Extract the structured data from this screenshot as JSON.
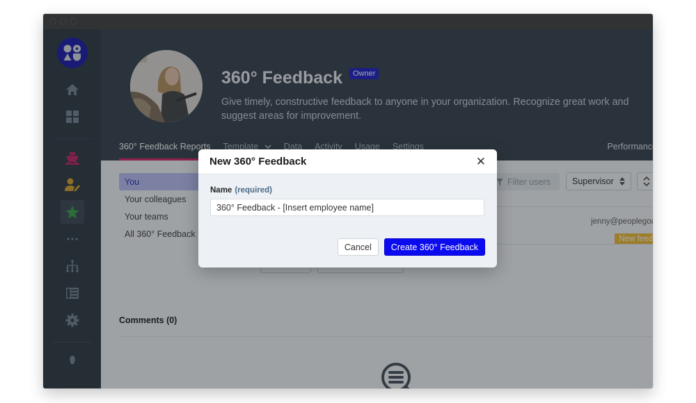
{
  "window": {
    "traffic_lights": [
      "close",
      "minimize",
      "maximize"
    ]
  },
  "sidebar": {
    "logo": "peoplegoal-logo",
    "items": [
      {
        "icon": "home-icon",
        "label": "Home",
        "color": "#6f7f8c"
      },
      {
        "icon": "grid-icon",
        "label": "Dashboard",
        "color": "#6f7f8c"
      },
      {
        "icon": "ship-icon",
        "label": "Onboarding",
        "color": "#c2185b"
      },
      {
        "icon": "user-edit-icon",
        "label": "Reviews",
        "color": "#d39e21"
      },
      {
        "icon": "star-icon",
        "label": "360° Feedback",
        "color": "#2e9e3e",
        "active": true
      },
      {
        "icon": "more-icon",
        "label": "More",
        "color": "#6f7f8c"
      },
      {
        "icon": "org-chart-icon",
        "label": "Org chart",
        "color": "#6f7f8c"
      },
      {
        "icon": "list-icon",
        "label": "Directory",
        "color": "#6f7f8c"
      },
      {
        "icon": "gear-icon",
        "label": "Settings",
        "color": "#6f7f8c"
      },
      {
        "icon": "lightbulb-icon",
        "label": "Tips",
        "color": "#6f7f8c"
      }
    ]
  },
  "header": {
    "title": "360° Feedback",
    "badge": "Owner",
    "description": "Give timely, constructive feedback to anyone in your organization. Recognize great work and suggest areas for improvement.",
    "tabs": [
      {
        "label": "360° Feedback Reports",
        "active": true
      },
      {
        "label": "Template",
        "dropdown": true
      },
      {
        "label": "Data"
      },
      {
        "label": "Activity"
      },
      {
        "label": "Usage"
      },
      {
        "label": "Settings"
      }
    ],
    "right_tab": "Performance",
    "accent": "#d81b60"
  },
  "subnav": {
    "items": [
      {
        "label": "You",
        "active": true
      },
      {
        "label": "Your colleagues"
      },
      {
        "label": "Your teams"
      },
      {
        "label": "All 360° Feedback"
      }
    ]
  },
  "list": {
    "filter_placeholder": "Filter users",
    "sort_select": "Supervisor",
    "row": {
      "email": "jenny@peoplegoa",
      "status_badge": "New feed"
    }
  },
  "comments": {
    "title": "Comments (0)"
  },
  "modal": {
    "title": "New 360° Feedback",
    "field_label": "Name",
    "field_required": "(required)",
    "name_value": "360° Feedback - [Insert employee name]",
    "cancel_label": "Cancel",
    "create_label": "Create 360° Feedback",
    "primary_color": "#0b0bf0"
  }
}
